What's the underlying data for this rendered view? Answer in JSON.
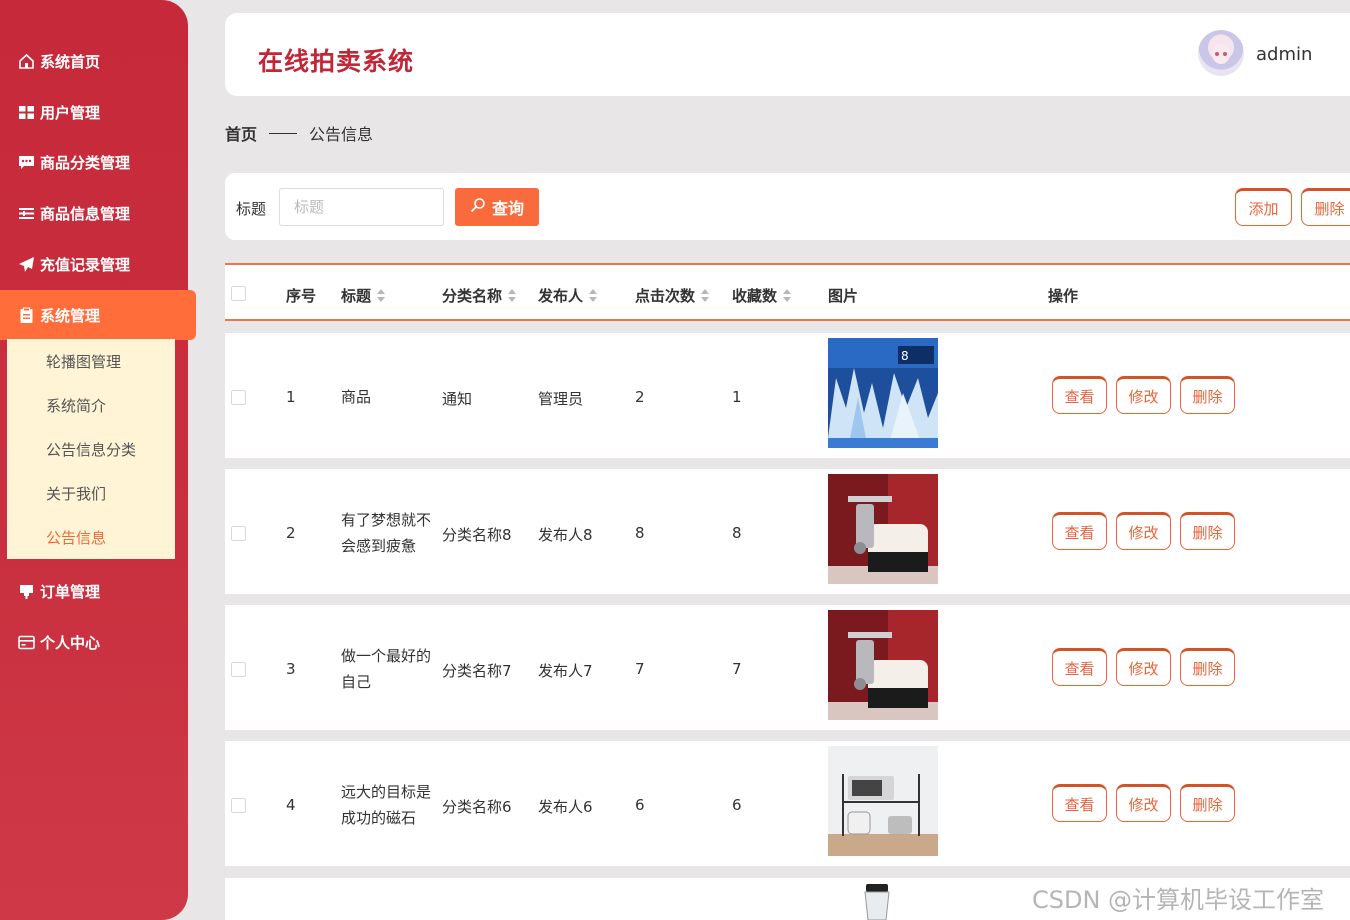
{
  "app": {
    "title": "在线拍卖系统",
    "username": "admin"
  },
  "sidebar": {
    "items": [
      {
        "label": "系统首页",
        "icon": "home-icon"
      },
      {
        "label": "用户管理",
        "icon": "grid-icon"
      },
      {
        "label": "商品分类管理",
        "icon": "chat-icon"
      },
      {
        "label": "商品信息管理",
        "icon": "list-icon"
      },
      {
        "label": "充值记录管理",
        "icon": "send-icon"
      },
      {
        "label": "系统管理",
        "icon": "clipboard-icon"
      },
      {
        "label": "订单管理",
        "icon": "cup-icon"
      },
      {
        "label": "个人中心",
        "icon": "card-icon"
      }
    ],
    "submenu": [
      "轮播图管理",
      "系统简介",
      "公告信息分类",
      "关于我们",
      "公告信息"
    ]
  },
  "breadcrumb": {
    "home": "首页",
    "current": "公告信息"
  },
  "search": {
    "label": "标题",
    "placeholder": "标题",
    "query_label": "查询",
    "add_label": "添加",
    "delete_label": "删除"
  },
  "table": {
    "headers": {
      "index": "序号",
      "title": "标题",
      "category": "分类名称",
      "publisher": "发布人",
      "clicks": "点击次数",
      "favorites": "收藏数",
      "image": "图片",
      "actions": "操作"
    },
    "action_labels": {
      "view": "查看",
      "edit": "修改",
      "delete": "删除"
    },
    "rows": [
      {
        "index": "1",
        "title": "商品",
        "category": "通知",
        "publisher": "管理员",
        "clicks": "2",
        "favorites": "1",
        "image": "ice-exhibit"
      },
      {
        "index": "2",
        "title": "有了梦想就不会感到疲惫",
        "category": "分类名称8",
        "publisher": "发布人8",
        "clicks": "8",
        "favorites": "8",
        "image": "meat-grinder"
      },
      {
        "index": "3",
        "title": "做一个最好的自己",
        "category": "分类名称7",
        "publisher": "发布人7",
        "clicks": "7",
        "favorites": "7",
        "image": "meat-grinder"
      },
      {
        "index": "4",
        "title": "远大的目标是成功的磁石",
        "category": "分类名称6",
        "publisher": "发布人6",
        "clicks": "6",
        "favorites": "6",
        "image": "kitchen-rack"
      }
    ]
  },
  "watermark": "CSDN @计算机毕设工作室",
  "colors": {
    "sidebar": "#c6293a",
    "accent": "#f96b3c",
    "title": "#c0283a",
    "submenu_bg": "#fff4d6"
  }
}
